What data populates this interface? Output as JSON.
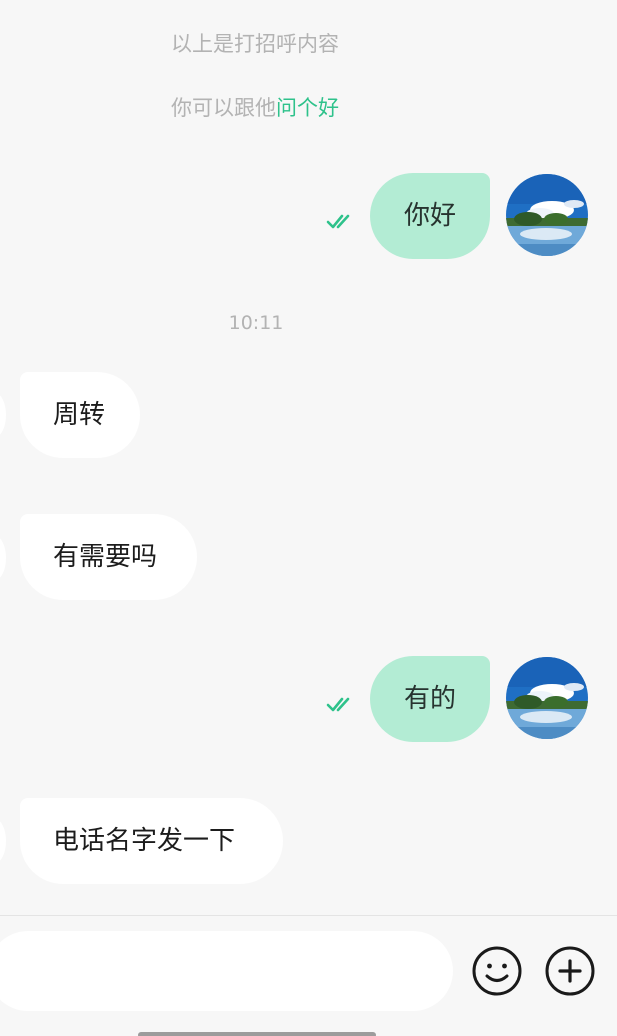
{
  "system": {
    "greeting_note": "以上是打招呼内容",
    "suggest_prefix": "你可以跟他",
    "suggest_link": "问个好"
  },
  "messages": [
    {
      "direction": "out",
      "text": "你好",
      "status": "read"
    },
    {
      "direction": "time",
      "text": "10:11"
    },
    {
      "direction": "in",
      "text": "周转"
    },
    {
      "direction": "in",
      "text": "有需要吗"
    },
    {
      "direction": "out",
      "text": "有的",
      "status": "read"
    },
    {
      "direction": "in",
      "text": "电话名字发一下"
    }
  ],
  "composer": {
    "input_value": "",
    "input_placeholder": "",
    "emoji_icon": "smiley-face-icon",
    "more_icon": "plus-circle-icon"
  },
  "colors": {
    "accent": "#2ec28b",
    "outgoing_bubble": "#b3ecd4",
    "incoming_bubble": "#ffffff",
    "background": "#f7f7f7"
  }
}
